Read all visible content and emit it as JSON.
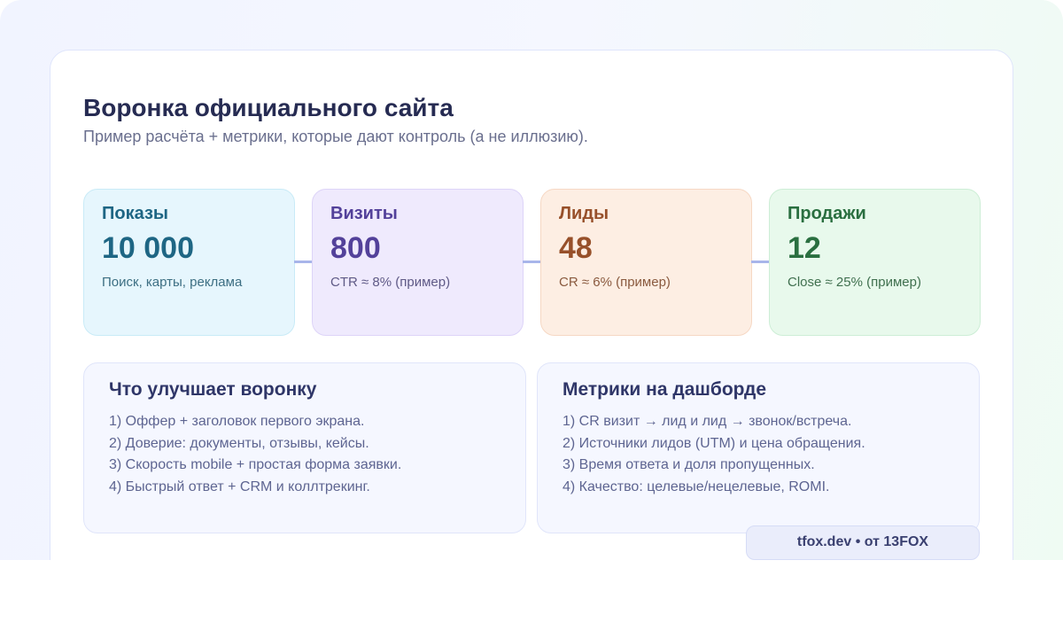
{
  "header": {
    "title": "Воронка официального сайта",
    "subtitle": "Пример расчёта + метрики, которые дают контроль (а не иллюзию)."
  },
  "funnel": [
    {
      "name": "Показы",
      "value": "10 000",
      "note": "Поиск, карты, реклама",
      "color": "#1e6684"
    },
    {
      "name": "Визиты",
      "value": "800",
      "note": "CTR ≈ 8% (пример)",
      "color": "#53419a"
    },
    {
      "name": "Лиды",
      "value": "48",
      "note": "CR ≈ 6% (пример)",
      "color": "#97502a"
    },
    {
      "name": "Продажи",
      "value": "12",
      "note": "Close ≈ 25% (пример)",
      "color": "#2a6f40"
    }
  ],
  "improve_panel": {
    "title": "Что улучшает воронку",
    "items": [
      "1) Оффер + заголовок первого экрана.",
      "2) Доверие: документы, отзывы, кейсы.",
      "3) Скорость mobile + простая форма заявки.",
      "4) Быстрый ответ + CRM и коллтрекинг."
    ]
  },
  "metrics_panel": {
    "title": "Метрики на дашборде",
    "items": [
      "1) CR визит → лид и лид → звонок/встреча.",
      "2) Источники лидов (UTM) и цена обращения.",
      "3) Время ответа и доля пропущенных.",
      "4) Качество: целевые/нецелевые, ROMI."
    ]
  },
  "footer": {
    "badge": "tfox.dev • от 13FOX"
  }
}
